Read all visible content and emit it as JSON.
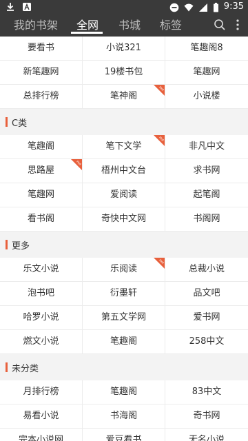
{
  "status_bar": {
    "time": "9:35",
    "left_icons": [
      "download-icon",
      "app-a-icon"
    ],
    "right_icons": [
      "minus-circle-icon",
      "wifi-icon",
      "signal-icon",
      "battery-icon"
    ]
  },
  "top_bar": {
    "tabs": [
      {
        "label": "我的书架",
        "active": false
      },
      {
        "label": "全网",
        "active": true
      },
      {
        "label": "书城",
        "active": false
      },
      {
        "label": "标签",
        "active": false
      }
    ],
    "icons": [
      "search-icon",
      "more-vert-icon"
    ]
  },
  "hot_badge_text": "Hot",
  "top_group": {
    "items": [
      {
        "label": "要看书"
      },
      {
        "label": "小说321"
      },
      {
        "label": "笔趣阁8"
      },
      {
        "label": "新笔趣网"
      },
      {
        "label": "19楼书包"
      },
      {
        "label": "笔趣网"
      },
      {
        "label": "总排行榜"
      },
      {
        "label": "笔神阁",
        "hot": true
      },
      {
        "label": "小说楼"
      }
    ]
  },
  "sections": [
    {
      "title": "C类",
      "items": [
        {
          "label": "笔趣阁"
        },
        {
          "label": "笔下文学",
          "hot": true
        },
        {
          "label": "非凡中文"
        },
        {
          "label": "思路屋",
          "hot": true
        },
        {
          "label": "梧州中文台"
        },
        {
          "label": "求书网"
        },
        {
          "label": "笔趣网"
        },
        {
          "label": "爱阅读"
        },
        {
          "label": "起笔阁"
        },
        {
          "label": "看书阁"
        },
        {
          "label": "奇快中文网"
        },
        {
          "label": "书阁网"
        }
      ]
    },
    {
      "title": "更多",
      "items": [
        {
          "label": "乐文小说"
        },
        {
          "label": "乐阅读",
          "hot": true
        },
        {
          "label": "总裁小说"
        },
        {
          "label": "泡书吧"
        },
        {
          "label": "衍墨轩"
        },
        {
          "label": "品文吧"
        },
        {
          "label": "哈罗小说"
        },
        {
          "label": "第五文学网"
        },
        {
          "label": "爱书网"
        },
        {
          "label": "燃文小说"
        },
        {
          "label": "笔趣阁"
        },
        {
          "label": "258中文"
        }
      ]
    },
    {
      "title": "未分类",
      "items": [
        {
          "label": "月排行榜"
        },
        {
          "label": "笔趣阁"
        },
        {
          "label": "83中文"
        },
        {
          "label": "易看小说"
        },
        {
          "label": "书海阁"
        },
        {
          "label": "奇书网"
        },
        {
          "label": "完本小说网"
        },
        {
          "label": "爱豆看书"
        },
        {
          "label": "无名小说"
        }
      ]
    }
  ],
  "colors": {
    "top_bar_bg": "#3a3a3a",
    "accent": "#e8603c",
    "page_bg": "#ececec",
    "cell_bg": "#ffffff"
  }
}
